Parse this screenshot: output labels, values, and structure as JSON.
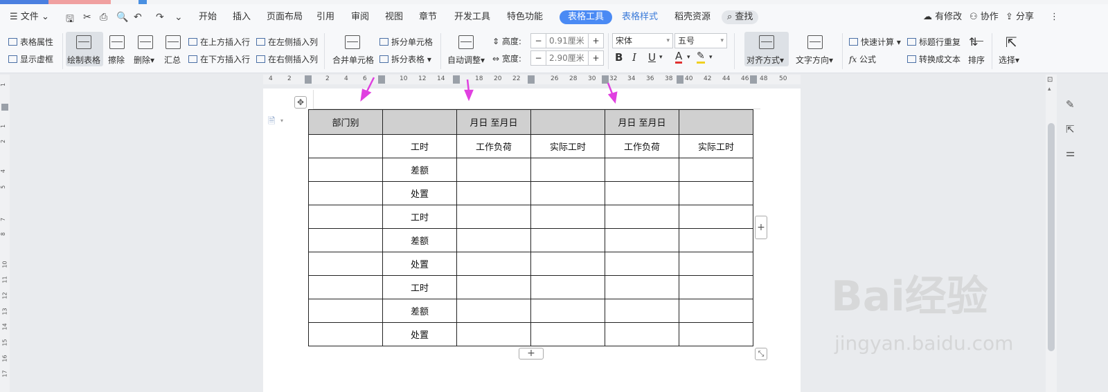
{
  "menubar": {
    "file": "文件",
    "tabs": [
      "开始",
      "插入",
      "页面布局",
      "引用",
      "审阅",
      "视图",
      "章节",
      "开发工具",
      "特色功能",
      "表格工具",
      "表格样式",
      "稻壳资源"
    ],
    "active_tab": "表格工具",
    "search": "查找",
    "right": {
      "modified": "有修改",
      "collab": "协作",
      "share": "分享"
    }
  },
  "ribbon": {
    "table_props": "表格属性",
    "show_grid": "显示虚框",
    "draw_table": "绘制表格",
    "erase": "擦除",
    "delete": "删除",
    "summary": "汇总",
    "insert_above": "在上方插入行",
    "insert_below": "在下方插入行",
    "insert_left": "在左侧插入列",
    "insert_right": "在右侧插入列",
    "merge_cells": "合并单元格",
    "split_cells": "拆分单元格",
    "split_table": "拆分表格",
    "auto_adjust": "自动调整",
    "height_label": "高度:",
    "height_value": "0.91厘米",
    "width_label": "宽度:",
    "width_value": "2.90厘米",
    "font_name": "宋体",
    "font_size": "五号",
    "align": "对齐方式",
    "text_dir": "文字方向",
    "quick_calc": "快速计算",
    "formula": "公式",
    "repeat_header": "标题行重复",
    "to_text": "转换成文本",
    "sort": "排序",
    "select": "选择"
  },
  "ruler": {
    "h_ticks": [
      "4",
      "2",
      "2",
      "4",
      "6",
      "10",
      "12",
      "14",
      "18",
      "20",
      "22",
      "26",
      "28",
      "30",
      "32",
      "34",
      "36",
      "38",
      "40",
      "42",
      "44",
      "46",
      "48",
      "50"
    ],
    "v_ticks": [
      "1",
      "1",
      "2",
      "4",
      "5",
      "7",
      "8",
      "10",
      "11",
      "12",
      "13",
      "14",
      "15",
      "16",
      "17"
    ]
  },
  "table": {
    "header": [
      "部门别",
      "",
      "月日 至月日",
      "",
      "月日 至月日",
      ""
    ],
    "rows": [
      [
        "",
        "工时",
        "工作负荷",
        "实际工时",
        "工作负荷",
        "实际工时"
      ],
      [
        "",
        "差额",
        "",
        "",
        "",
        ""
      ],
      [
        "",
        "处置",
        "",
        "",
        "",
        ""
      ],
      [
        "",
        "工时",
        "",
        "",
        "",
        ""
      ],
      [
        "",
        "差额",
        "",
        "",
        "",
        ""
      ],
      [
        "",
        "处置",
        "",
        "",
        "",
        ""
      ],
      [
        "",
        "工时",
        "",
        "",
        "",
        ""
      ],
      [
        "",
        "差额",
        "",
        "",
        "",
        ""
      ],
      [
        "",
        "处置",
        "",
        "",
        "",
        ""
      ]
    ]
  },
  "colors": {
    "accent": "#4a8af4",
    "arrow": "#e040e0",
    "header_fill": "#d0d0d0"
  },
  "watermark": {
    "brand": "Bai经验",
    "url": "jingyan.baidu.com"
  }
}
